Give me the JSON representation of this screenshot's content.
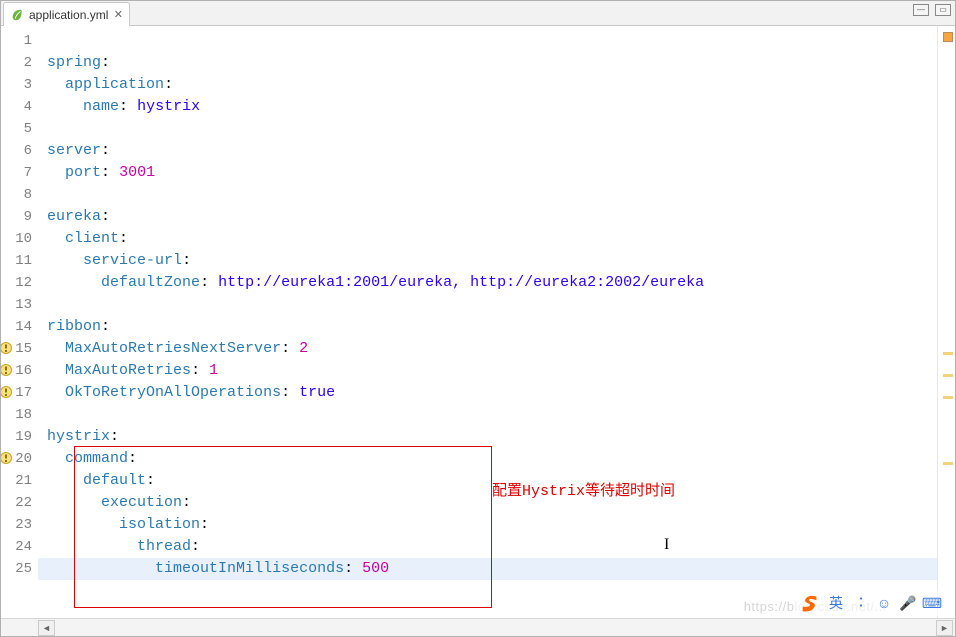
{
  "tab": {
    "filename": "application.yml"
  },
  "annotation": "配置Hystrix等待超时时间",
  "watermark": "https://blog.csdn.net/...",
  "lines": [
    {
      "n": 1,
      "seg": []
    },
    {
      "n": 2,
      "seg": [
        {
          "t": "spring",
          "c": "key"
        },
        {
          "t": ":",
          "c": "col"
        }
      ]
    },
    {
      "n": 3,
      "seg": [
        {
          "t": "  ",
          "c": ""
        },
        {
          "t": "application",
          "c": "key"
        },
        {
          "t": ":",
          "c": "col"
        }
      ]
    },
    {
      "n": 4,
      "seg": [
        {
          "t": "    ",
          "c": ""
        },
        {
          "t": "name",
          "c": "key"
        },
        {
          "t": ": ",
          "c": "col"
        },
        {
          "t": "hystrix",
          "c": "str"
        }
      ]
    },
    {
      "n": 5,
      "seg": []
    },
    {
      "n": 6,
      "seg": [
        {
          "t": "server",
          "c": "key"
        },
        {
          "t": ":",
          "c": "col"
        }
      ]
    },
    {
      "n": 7,
      "seg": [
        {
          "t": "  ",
          "c": ""
        },
        {
          "t": "port",
          "c": "key"
        },
        {
          "t": ": ",
          "c": "col"
        },
        {
          "t": "3001",
          "c": "num"
        }
      ]
    },
    {
      "n": 8,
      "seg": []
    },
    {
      "n": 9,
      "seg": [
        {
          "t": "eureka",
          "c": "key"
        },
        {
          "t": ":",
          "c": "col"
        }
      ]
    },
    {
      "n": 10,
      "seg": [
        {
          "t": "  ",
          "c": ""
        },
        {
          "t": "client",
          "c": "key"
        },
        {
          "t": ":",
          "c": "col"
        }
      ]
    },
    {
      "n": 11,
      "seg": [
        {
          "t": "    ",
          "c": ""
        },
        {
          "t": "service-url",
          "c": "key"
        },
        {
          "t": ":",
          "c": "col"
        }
      ]
    },
    {
      "n": 12,
      "seg": [
        {
          "t": "      ",
          "c": ""
        },
        {
          "t": "defaultZone",
          "c": "key"
        },
        {
          "t": ": ",
          "c": "col"
        },
        {
          "t": "http://eureka1:2001/eureka",
          "c": "str"
        },
        {
          "t": ", ",
          "c": "comma"
        },
        {
          "t": "http://eureka2:2002/eureka",
          "c": "str"
        }
      ]
    },
    {
      "n": 13,
      "seg": []
    },
    {
      "n": 14,
      "seg": [
        {
          "t": "ribbon",
          "c": "key"
        },
        {
          "t": ":",
          "c": "col"
        }
      ]
    },
    {
      "n": 15,
      "marker": true,
      "seg": [
        {
          "t": "  ",
          "c": ""
        },
        {
          "t": "MaxAutoRetriesNextServer",
          "c": "key"
        },
        {
          "t": ": ",
          "c": "col"
        },
        {
          "t": "2",
          "c": "num"
        }
      ]
    },
    {
      "n": 16,
      "marker": true,
      "seg": [
        {
          "t": "  ",
          "c": ""
        },
        {
          "t": "MaxAutoRetries",
          "c": "key"
        },
        {
          "t": ": ",
          "c": "col"
        },
        {
          "t": "1",
          "c": "num"
        }
      ]
    },
    {
      "n": 17,
      "marker": true,
      "seg": [
        {
          "t": "  ",
          "c": ""
        },
        {
          "t": "OkToRetryOnAllOperations",
          "c": "key"
        },
        {
          "t": ": ",
          "c": "col"
        },
        {
          "t": "true",
          "c": "str"
        }
      ]
    },
    {
      "n": 18,
      "seg": []
    },
    {
      "n": 19,
      "seg": [
        {
          "t": "hystrix",
          "c": "key"
        },
        {
          "t": ":",
          "c": "col"
        }
      ]
    },
    {
      "n": 20,
      "marker": true,
      "seg": [
        {
          "t": "  ",
          "c": ""
        },
        {
          "t": "command",
          "c": "key"
        },
        {
          "t": ":",
          "c": "col"
        }
      ]
    },
    {
      "n": 21,
      "seg": [
        {
          "t": "    ",
          "c": ""
        },
        {
          "t": "default",
          "c": "key"
        },
        {
          "t": ":",
          "c": "col"
        }
      ]
    },
    {
      "n": 22,
      "seg": [
        {
          "t": "      ",
          "c": ""
        },
        {
          "t": "execution",
          "c": "key"
        },
        {
          "t": ":",
          "c": "col"
        }
      ]
    },
    {
      "n": 23,
      "seg": [
        {
          "t": "        ",
          "c": ""
        },
        {
          "t": "isolation",
          "c": "key"
        },
        {
          "t": ":",
          "c": "col"
        }
      ]
    },
    {
      "n": 24,
      "seg": [
        {
          "t": "          ",
          "c": ""
        },
        {
          "t": "thread",
          "c": "key"
        },
        {
          "t": ":",
          "c": "col"
        }
      ]
    },
    {
      "n": 25,
      "hl": true,
      "seg": [
        {
          "t": "            ",
          "c": ""
        },
        {
          "t": "timeoutInMilliseconds",
          "c": "key"
        },
        {
          "t": ": ",
          "c": "col"
        },
        {
          "t": "500",
          "c": "num"
        }
      ]
    }
  ],
  "ime": [
    "英",
    "•",
    "☺",
    "🎤",
    "⌨"
  ]
}
